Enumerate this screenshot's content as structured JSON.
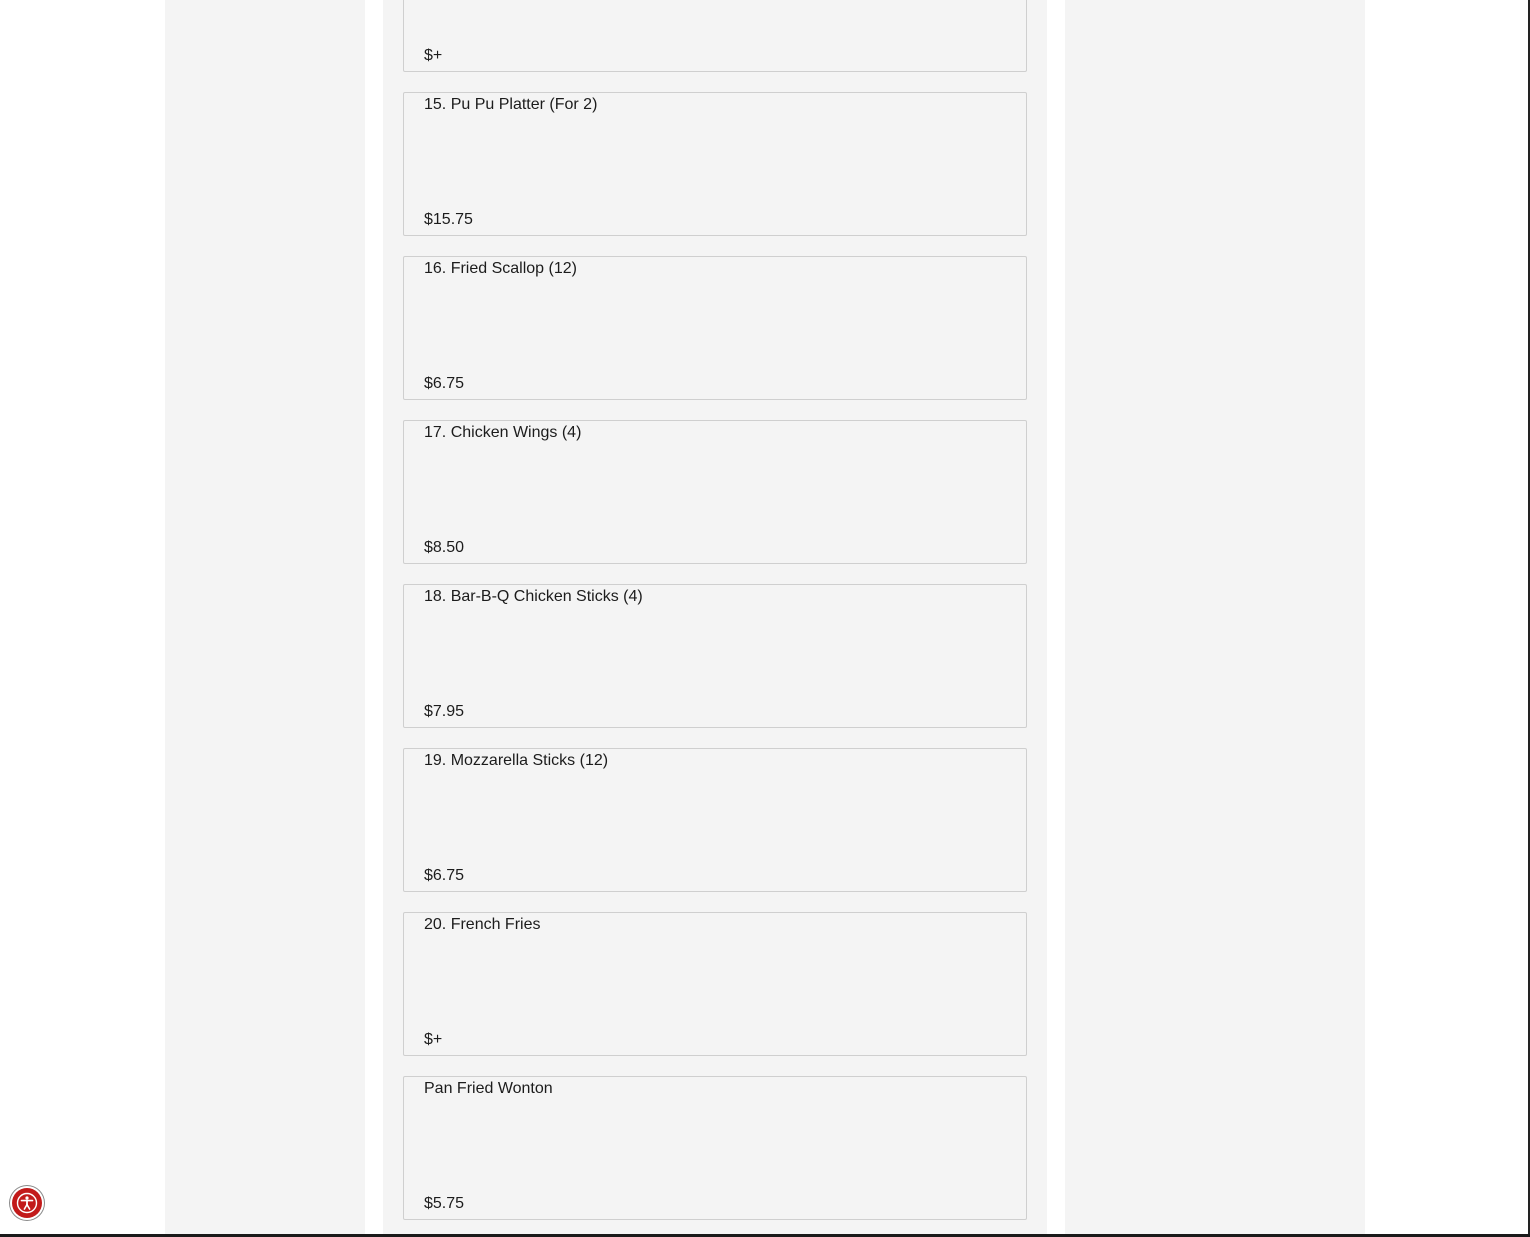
{
  "menu": {
    "items": [
      {
        "name": "",
        "price": "$+"
      },
      {
        "name": "15. Pu Pu Platter (For 2)",
        "price": "$15.75"
      },
      {
        "name": "16. Fried Scallop (12)",
        "price": "$6.75"
      },
      {
        "name": "17. Chicken Wings (4)",
        "price": "$8.50"
      },
      {
        "name": "18. Bar-B-Q Chicken Sticks (4)",
        "price": "$7.95"
      },
      {
        "name": "19. Mozzarella Sticks (12)",
        "price": "$6.75"
      },
      {
        "name": "20. French Fries",
        "price": "$+"
      },
      {
        "name": "Pan Fried Wonton",
        "price": "$5.75"
      }
    ]
  },
  "accessibility": {
    "icon": "accessibility-icon",
    "color": "#c21a1a"
  }
}
